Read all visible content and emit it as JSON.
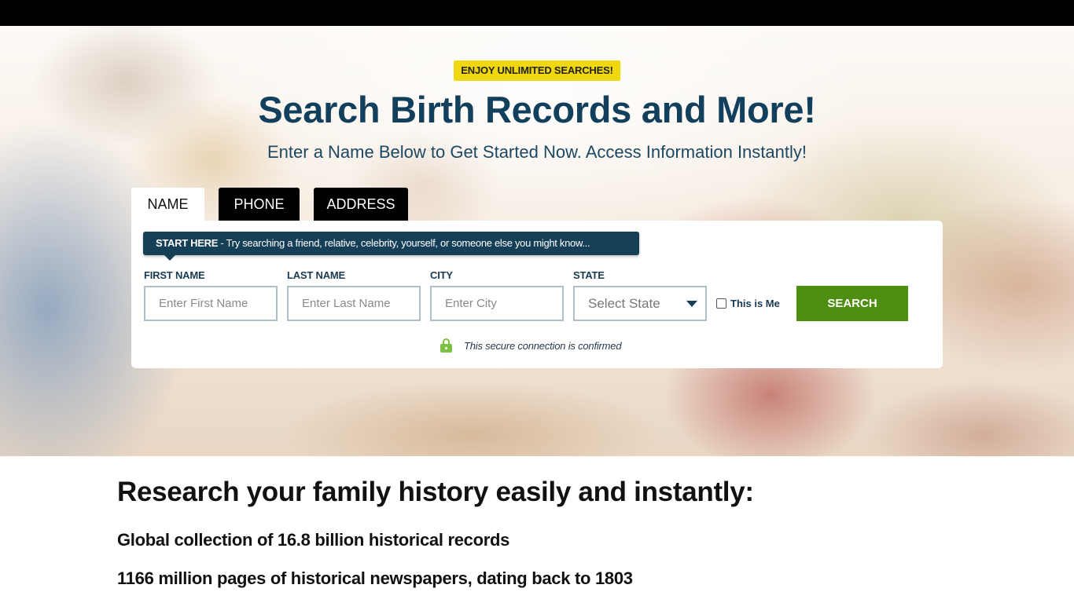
{
  "promo_badge": "ENJOY UNLIMITED SEARCHES!",
  "hero": {
    "title": "Search Birth Records and More!",
    "subtitle": "Enter a Name Below to Get Started Now. Access Information Instantly!"
  },
  "tabs": [
    {
      "label": "NAME",
      "active": true
    },
    {
      "label": "PHONE",
      "active": false
    },
    {
      "label": "ADDRESS",
      "active": false
    }
  ],
  "search_form": {
    "tip_strong": "START HERE",
    "tip_text": " - Try searching a friend, relative, celebrity, yourself, or someone else you might know...",
    "fields": {
      "first_name": {
        "label": "FIRST NAME",
        "placeholder": "Enter First Name",
        "value": ""
      },
      "last_name": {
        "label": "LAST NAME",
        "placeholder": "Enter Last Name",
        "value": ""
      },
      "city": {
        "label": "CITY",
        "placeholder": "Enter City",
        "value": ""
      },
      "state": {
        "label": "STATE",
        "selected": "Select State"
      }
    },
    "this_is_me_label": "This is Me",
    "this_is_me_checked": false,
    "search_button": "SEARCH",
    "secure_text": "This secure connection is confirmed"
  },
  "content": {
    "title": "Research your family history easily and instantly:",
    "facts": [
      "Global collection of 16.8 billion historical records",
      "1166 million pages of historical newspapers, dating back to 1803"
    ]
  },
  "colors": {
    "primary_navy": "#123f5c",
    "tip_bg": "#153e57",
    "badge_yellow": "#f0d80c",
    "search_green": "#4e8f12",
    "lock_green": "#7cc142"
  }
}
